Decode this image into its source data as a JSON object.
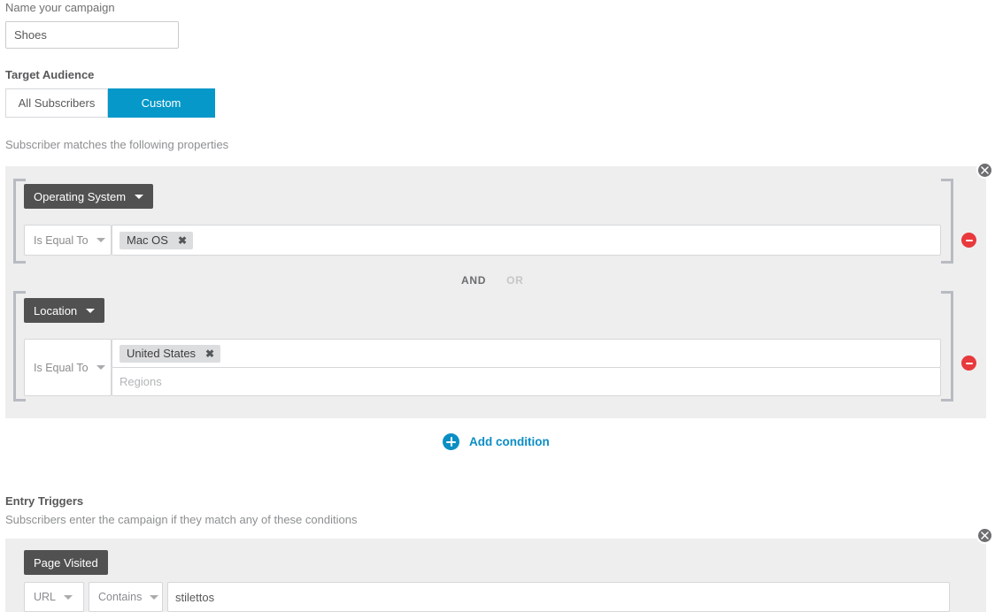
{
  "campaign": {
    "name_label": "Name your campaign",
    "name_value": "Shoes",
    "name_placeholder": "Name your campaign"
  },
  "target_audience": {
    "heading": "Target Audience",
    "options": [
      {
        "label": "All Subscribers",
        "active": false
      },
      {
        "label": "Custom",
        "active": true
      }
    ],
    "helper": "Subscriber matches the following properties"
  },
  "conditions": {
    "close_label": "×",
    "conjunction": {
      "and": "AND",
      "or": "OR",
      "selected": "AND"
    },
    "groups": [
      {
        "property": "Operating System",
        "operator": "Is Equal To",
        "chips": [
          {
            "label": "Mac OS",
            "remove": "✖"
          }
        ],
        "rows": []
      },
      {
        "property": "Location",
        "operator": "Is Equal To",
        "chips": [
          {
            "label": "United States",
            "remove": "✖"
          }
        ],
        "rows": [
          {
            "placeholder": "Regions"
          }
        ]
      }
    ],
    "add_condition": "Add condition"
  },
  "entry_triggers": {
    "heading": "Entry Triggers",
    "helper": "Subscribers enter the campaign if they match any of these conditions",
    "close_label": "×",
    "trigger": {
      "property": "Page Visited",
      "field": "URL",
      "operator": "Contains",
      "value": "stilettos",
      "value_placeholder": "stilettos"
    }
  },
  "colors": {
    "accent": "#0598c8",
    "tag": "#515151",
    "panel": "#eeeeee",
    "danger": "#e8393c"
  }
}
